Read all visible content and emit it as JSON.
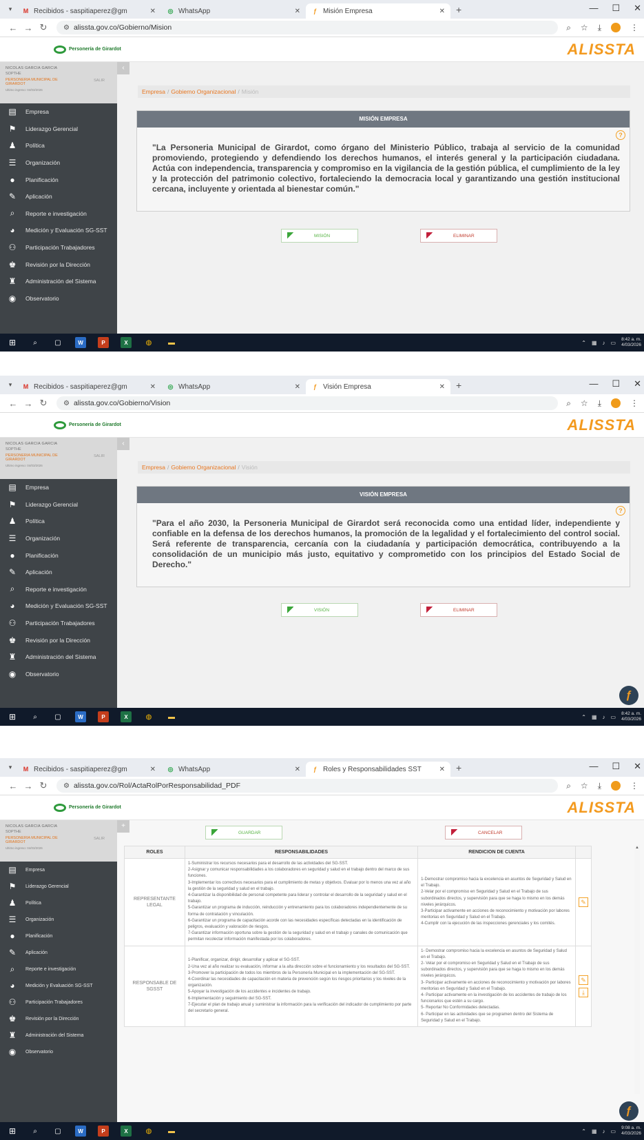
{
  "browser": {
    "tabs_common": [
      {
        "label": "Recibidos - saspitiaperez@gm",
        "icon": "gmail-icon"
      },
      {
        "label": "WhatsApp",
        "icon": "whatsapp-icon"
      }
    ],
    "new_tab": "+",
    "win": {
      "min": "—",
      "max": "☐",
      "close": "✕"
    }
  },
  "shots": [
    {
      "active_tab": "Misión Empresa",
      "url": "alissta.gov.co/Gobierno/Mision",
      "breadcrumb": [
        "Empresa",
        "Gobierno Organizacional",
        "Misión"
      ],
      "panel_title": "MISIÓN EMPRESA",
      "statement": "\"La Personeria Municipal de Girardot, como órgano del Ministerio Público, trabaja al servicio de la comunidad promoviendo, protegiendo y defendiendo los derechos humanos, el interés general y la participación ciudadana. Actúa con independencia, transparencia y compromiso en la vigilancia de la gestión pública, el cumplimiento de la ley y la protección del patrimonio colectivo, fortaleciendo la democracia local y garantizando una gestión institucional cercana, incluyente y orientada al bienestar común.\"",
      "btn_green": "MISIÓN",
      "btn_red": "ELIMINAR"
    },
    {
      "active_tab": "Visión Empresa",
      "url": "alissta.gov.co/Gobierno/Vision",
      "breadcrumb": [
        "Empresa",
        "Gobierno Organizacional",
        "Visión"
      ],
      "panel_title": "VISIÓN EMPRESA",
      "statement": "\"Para el año 2030, la Personeria Municipal de Girardot será reconocida como una entidad líder, independiente y confiable en la defensa de los derechos humanos, la promoción de la legalidad y el fortalecimiento del control social. Será referente de transparencia, cercanía con la ciudadanía y participación democrática, contribuyendo a la consolidación de un municipio más justo, equitativo y comprometido con los principios del Estado Social de Derecho.\"",
      "btn_green": "VISIÓN",
      "btn_red": "ELIMINAR"
    },
    {
      "active_tab": "Roles y Responsabilidades SST",
      "url": "alissta.gov.co/Rol/ActaRolPorResponsabilidad_PDF",
      "btn_green": "GUARDAR",
      "btn_red": "CANCELAR",
      "table": {
        "headers": [
          "ROLES",
          "RESPONSABILIDADES",
          "RENDICION DE CUENTA"
        ],
        "rows": [
          {
            "role": "REPRESENTANTE LEGAL",
            "resp": [
              "1-Suministrar los recursos necesarios para el desarrollo de las actividades del SG-SST.",
              "2-Asignar y comunicar responsabilidades a los colaboradores en seguridad y salud en el trabajo dentro del marco de sus funciones.",
              "3-Implementar los correctivos necesarios para el cumplimiento de metas y objetivos. Evaluar por lo menos una vez al año la gestión de la seguridad y salud en el trabajo.",
              "4-Garantizar la disponibilidad de personal competente para liderar y controlar el desarrollo de la seguridad y salud en el trabajo.",
              "5-Garantizar un programa de inducción, reinducción y entrenamiento para los colaboradores independientemente de su forma de contratación y vinculación.",
              "6-Garantizar un programa de capacitación acorde con las necesidades específicas detectadas en la identificación de peligros, evaluación y valoración de riesgos.",
              "7-Garantizar información oportuna sobre la gestión de la seguridad y salud en el trabajo y canales de comunicación que permitan recolectar información manifestada por los colaboradores."
            ],
            "rend": [
              "1-Demostrar compromiso hacia la excelencia en asuntos de Seguridad y Salud en el Trabajo.",
              "2-Velar por el compromiso en Seguridad y Salud en el Trabajo de sus subordinados directos, y supervisión para que se haga lo mismo en los demás niveles jerárquicos.",
              "3-Participar activamente en acciones de reconocimiento y motivación por labores meritorias en Seguridad y Salud en el Trabajo.",
              "4-Cumplir con la ejecución de las inspecciones gerenciales y los comités."
            ]
          },
          {
            "role": "RESPONSABLE DE SGSST",
            "resp": [
              "1-Planificar, organizar, dirigir, desarrollar y aplicar el SG-SST.",
              "2-Una vez al año realizar su evaluación, informar a la alta dirección sobre el funcionamiento y los resultados del SG-SST.",
              "3-Promover la participación de todos los miembros de la Personería Municipal en la implementación del SG-SST.",
              "4-Coordinar las necesidades de capacitación en materia de prevención según los riesgos prioritarios y los niveles de la organización.",
              "5-Apoyar la investigación de los accidentes e incidentes de trabajo.",
              "6-Implementación y seguimiento del SG-SST.",
              "7-Ejecutar el plan de trabajo anual y suministrar la información para la verificación del indicador de cumplimiento por parte del secretario general."
            ],
            "rend": [
              "1- Demostrar compromiso hacia la excelencia en asuntos de Seguridad y Salud en el Trabajo.",
              "2- Velar por el compromiso en Seguridad y Salud en el Trabajo de sus subordinados directos, y supervisión para que se haga lo mismo en los demás niveles jerárquicos.",
              "3- Participar activamente en acciones de reconocimiento y motivación por labores meritorias en Seguridad y Salud en el Trabajo.",
              "4- Participar activamente en la investigación de los accidentes de trabajo de los funcionarios que estén a su cargo.",
              "5- Reportar No Conformidades detectadas.",
              "6- Participar en las actividades que se programen dentro del Sistema de Seguridad y Salud en el Trabajo."
            ]
          }
        ]
      }
    }
  ],
  "header": {
    "org_logo_text": "Personería de Girardot",
    "brand": "ALISSTA"
  },
  "user": {
    "name": "NICOLAS GARCIA GARCIA",
    "role": "SOPTHE",
    "org": "PERSONERIA MUNICIPAL DE GIRARDOT",
    "date": "Ultimo ingreso: 04/03/2026",
    "logout": "SALIR"
  },
  "sidebar": {
    "items": [
      {
        "label": "Empresa",
        "icon": "building-icon"
      },
      {
        "label": "Liderazgo Gerencial",
        "icon": "leadership-icon"
      },
      {
        "label": "Política",
        "icon": "podium-icon"
      },
      {
        "label": "Organización",
        "icon": "list-icon"
      },
      {
        "label": "Planificación",
        "icon": "lightbulb-icon"
      },
      {
        "label": "Aplicación",
        "icon": "wrench-icon"
      },
      {
        "label": "Reporte e investigación",
        "icon": "magnify-icon"
      },
      {
        "label": "Medición y Evaluación SG-SST",
        "icon": "pie-chart-icon"
      },
      {
        "label": "Participación Trabajadores",
        "icon": "people-icon"
      },
      {
        "label": "Revisión por la Dirección",
        "icon": "manager-icon"
      },
      {
        "label": "Administración del Sistema",
        "icon": "admin-icon"
      },
      {
        "label": "Observatorio",
        "icon": "observatory-icon"
      }
    ]
  },
  "taskbar": {
    "time": "8:42 a. m.",
    "time3": "9:08 a. m.",
    "date": "4/03/2026"
  },
  "colors": {
    "sidebar": "#3f4448",
    "accent": "#e8761f",
    "panel_header": "#6f7781",
    "taskbar": "#101a2a"
  }
}
